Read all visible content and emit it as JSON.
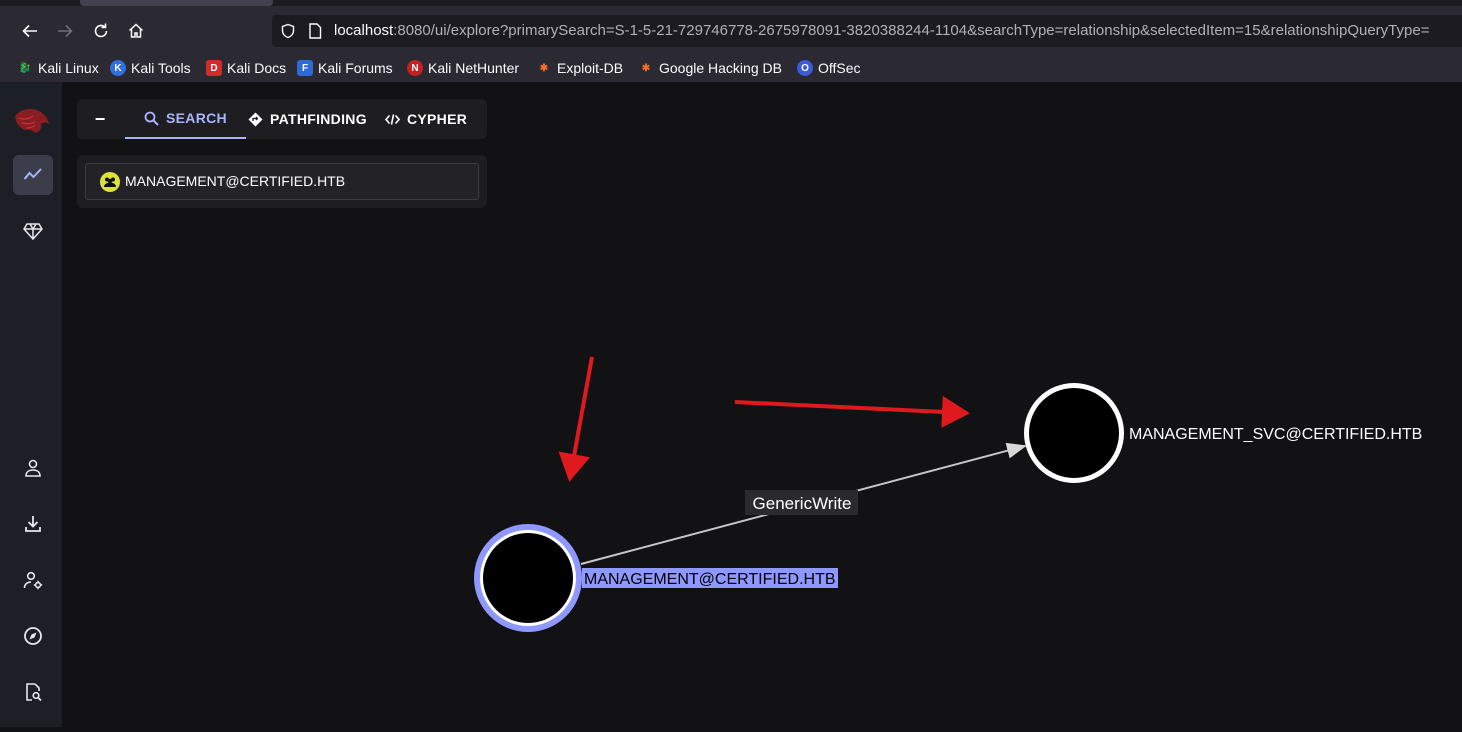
{
  "browser": {
    "url_host": "localhost",
    "url_rest": ":8080/ui/explore?primarySearch=S-1-5-21-729746778-2675978091-3820388244-1104&searchType=relationship&selectedItem=15&relationshipQueryType=",
    "bookmarks": [
      {
        "label": "Kali Linux"
      },
      {
        "label": "Kali Tools"
      },
      {
        "label": "Kali Docs"
      },
      {
        "label": "Kali Forums"
      },
      {
        "label": "Kali NetHunter"
      },
      {
        "label": "Exploit-DB"
      },
      {
        "label": "Google Hacking DB"
      },
      {
        "label": "OffSec"
      }
    ]
  },
  "explore": {
    "tabs": {
      "search": "SEARCH",
      "pathfinding": "PATHFINDING",
      "cypher": "CYPHER"
    },
    "search_value": "MANAGEMENT@CERTIFIED.HTB"
  },
  "graph": {
    "source_label": "MANAGEMENT@CERTIFIED.HTB",
    "target_label": "MANAGEMENT_SVC@CERTIFIED.HTB",
    "edge_label": "GenericWrite"
  },
  "colors": {
    "accent": "#a9b4ff",
    "selected_label_bg": "#8f98ff",
    "annotation_arrow": "#e0191f",
    "group_icon": "#dde23b"
  }
}
